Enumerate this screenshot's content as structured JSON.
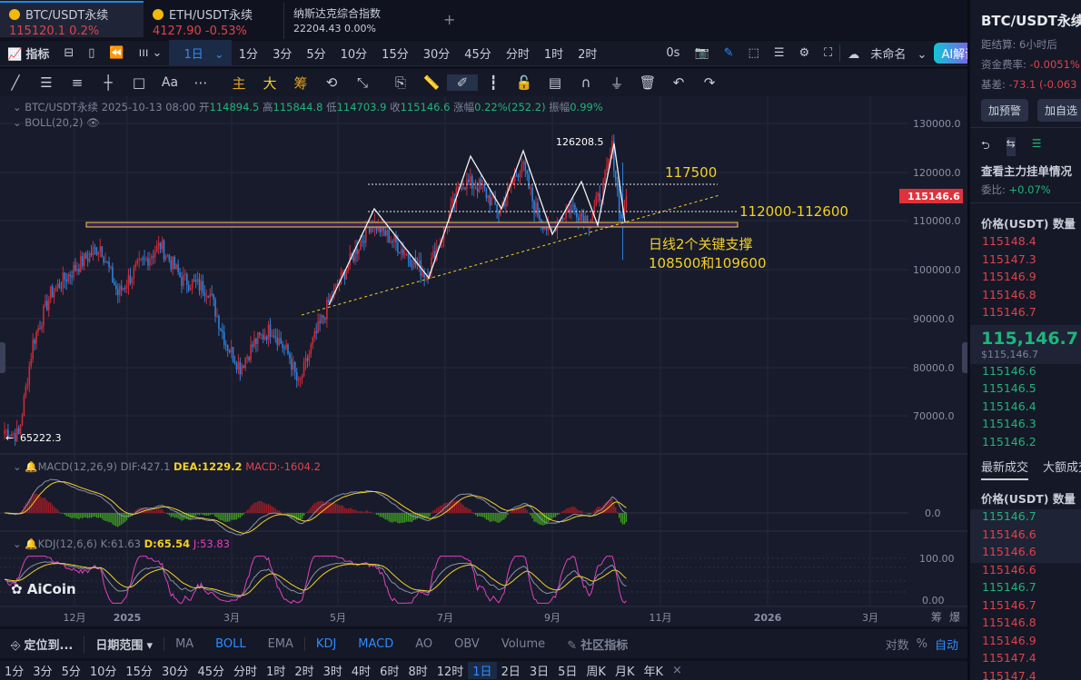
{
  "tabs": [
    {
      "name": "BTC/USDT永续",
      "price": "115120.1",
      "change": "0.2%"
    },
    {
      "name": "ETH/USDT永续",
      "price": "4127.90",
      "change": "-0.53%"
    },
    {
      "name": "纳斯达克综合指数",
      "price": "22204.43",
      "change": "0.00%"
    }
  ],
  "add_tab": "+",
  "toolbar": {
    "indicator": "指标",
    "interval": "1日",
    "intervals": [
      "1分",
      "3分",
      "5分",
      "10分",
      "15分",
      "30分",
      "45分",
      "分时",
      "1时",
      "2时"
    ],
    "countdown": "0s",
    "layout_name": "未命名",
    "ai": "AI解读"
  },
  "drawtools": {
    "main": "主",
    "big": "大",
    "chips": "筹"
  },
  "info": {
    "symbol": "BTC/USDT永续",
    "date": "2025-10-13 08:00",
    "open_l": "开",
    "open": "114894.5",
    "high_l": "高",
    "high": "115844.8",
    "low_l": "低",
    "low": "114703.9",
    "close_l": "收",
    "close": "115146.6",
    "chg_l": "涨幅",
    "chg": "0.22%(252.2)",
    "amp_l": "振幅",
    "amp": "0.99%",
    "boll": "BOLL(20,2)"
  },
  "price_axis": [
    "130000.0",
    "120000.0",
    "110000.0",
    "100000.0",
    "90000.0",
    "80000.0",
    "70000.0"
  ],
  "last_price": "115146.6",
  "annotations": {
    "high": "126208.5",
    "low": "65222.3",
    "r1": "117500",
    "r2": "112000-112600",
    "note1": "日线2个关键支撑",
    "note2": "108500和109600"
  },
  "macd": {
    "label": "MACD(12,26,9)",
    "dif": "DIF:427.1",
    "dea": "DEA:1229.2",
    "macd": "MACD:-1604.2",
    "zero": "0.0"
  },
  "kdj": {
    "label": "KDJ(12,6,6)",
    "k": "K:61.63",
    "d": "D:65.54",
    "j": "J:53.83",
    "top": "100.00",
    "bottom": "0.00"
  },
  "logo": "AiCoin",
  "time_axis": [
    "12月",
    "2025",
    "3月",
    "5月",
    "7月",
    "9月",
    "11月",
    "2026",
    "3月"
  ],
  "axis_right": [
    "筹",
    "爆"
  ],
  "bottom": {
    "locate": "定位到...",
    "range": "日期范围",
    "inds": [
      "MA",
      "BOLL",
      "EMA",
      "KDJ",
      "MACD",
      "AO",
      "OBV",
      "Volume"
    ],
    "community": "社区指标",
    "log": "对数",
    "pct": "%",
    "auto": "自动"
  },
  "bottom_intervals": [
    "1分",
    "3分",
    "5分",
    "10分",
    "15分",
    "30分",
    "45分",
    "分时",
    "1时",
    "2时",
    "3时",
    "4时",
    "6时",
    "8时",
    "12时",
    "1日",
    "2日",
    "3日",
    "5日",
    "周K",
    "月K",
    "年K"
  ],
  "bottom_close": "×",
  "right": {
    "title": "BTC/USDT永续",
    "settle_l": "距结算:",
    "settle": "6小时后",
    "fund_l": "资金费率:",
    "fund": "-0.0051%",
    "basis_l": "基差:",
    "basis": "-73.1 (-0.063",
    "alert": "加预警",
    "fav": "加自选",
    "orders": "查看主力挂单情况",
    "ratio_l": "委比:",
    "ratio": "+0.07%",
    "col": "价格(USDT) 数量",
    "asks": [
      "115148.4",
      "115147.3",
      "115146.9",
      "115146.8",
      "115146.7"
    ],
    "mid": "115,146.7",
    "mid_usd": "$115,146.7",
    "bids": [
      "115146.6",
      "115146.5",
      "115146.4",
      "115146.3",
      "115146.2"
    ],
    "tab1": "最新成交",
    "tab2": "大额成交",
    "col2": "价格(USDT) 数量",
    "trades": [
      [
        "115146.7",
        "g"
      ],
      [
        "115146.6",
        "r"
      ],
      [
        "115146.6",
        "r"
      ],
      [
        "115146.6",
        "r"
      ],
      [
        "115146.7",
        "g"
      ],
      [
        "115146.7",
        "r"
      ],
      [
        "115146.8",
        "r"
      ],
      [
        "115146.9",
        "r"
      ],
      [
        "115147.4",
        "r"
      ],
      [
        "115147.4",
        "r"
      ]
    ]
  },
  "chart_data": {
    "type": "candlestick",
    "anchors": [
      [
        0,
        67000
      ],
      [
        8,
        66000
      ],
      [
        16,
        85000
      ],
      [
        26,
        95000
      ],
      [
        39,
        100000
      ],
      [
        54,
        105000
      ],
      [
        64,
        95000
      ],
      [
        74,
        100000
      ],
      [
        88,
        105000
      ],
      [
        100,
        98000
      ],
      [
        115,
        96000
      ],
      [
        125,
        85000
      ],
      [
        133,
        80000
      ],
      [
        141,
        85000
      ],
      [
        151,
        88000
      ],
      [
        161,
        82000
      ],
      [
        166,
        76000
      ],
      [
        174,
        85000
      ],
      [
        184,
        94000
      ],
      [
        197,
        103000
      ],
      [
        207,
        110000
      ],
      [
        222,
        105000
      ],
      [
        238,
        99000
      ],
      [
        248,
        108000
      ],
      [
        258,
        118000
      ],
      [
        269,
        117000
      ],
      [
        279,
        112000
      ],
      [
        292,
        122000
      ],
      [
        299,
        113000
      ],
      [
        307,
        108000
      ],
      [
        320,
        113000
      ],
      [
        330,
        110000
      ],
      [
        338,
        117000
      ],
      [
        343,
        125000
      ],
      [
        348,
        110000
      ],
      [
        351,
        115146
      ]
    ]
  }
}
